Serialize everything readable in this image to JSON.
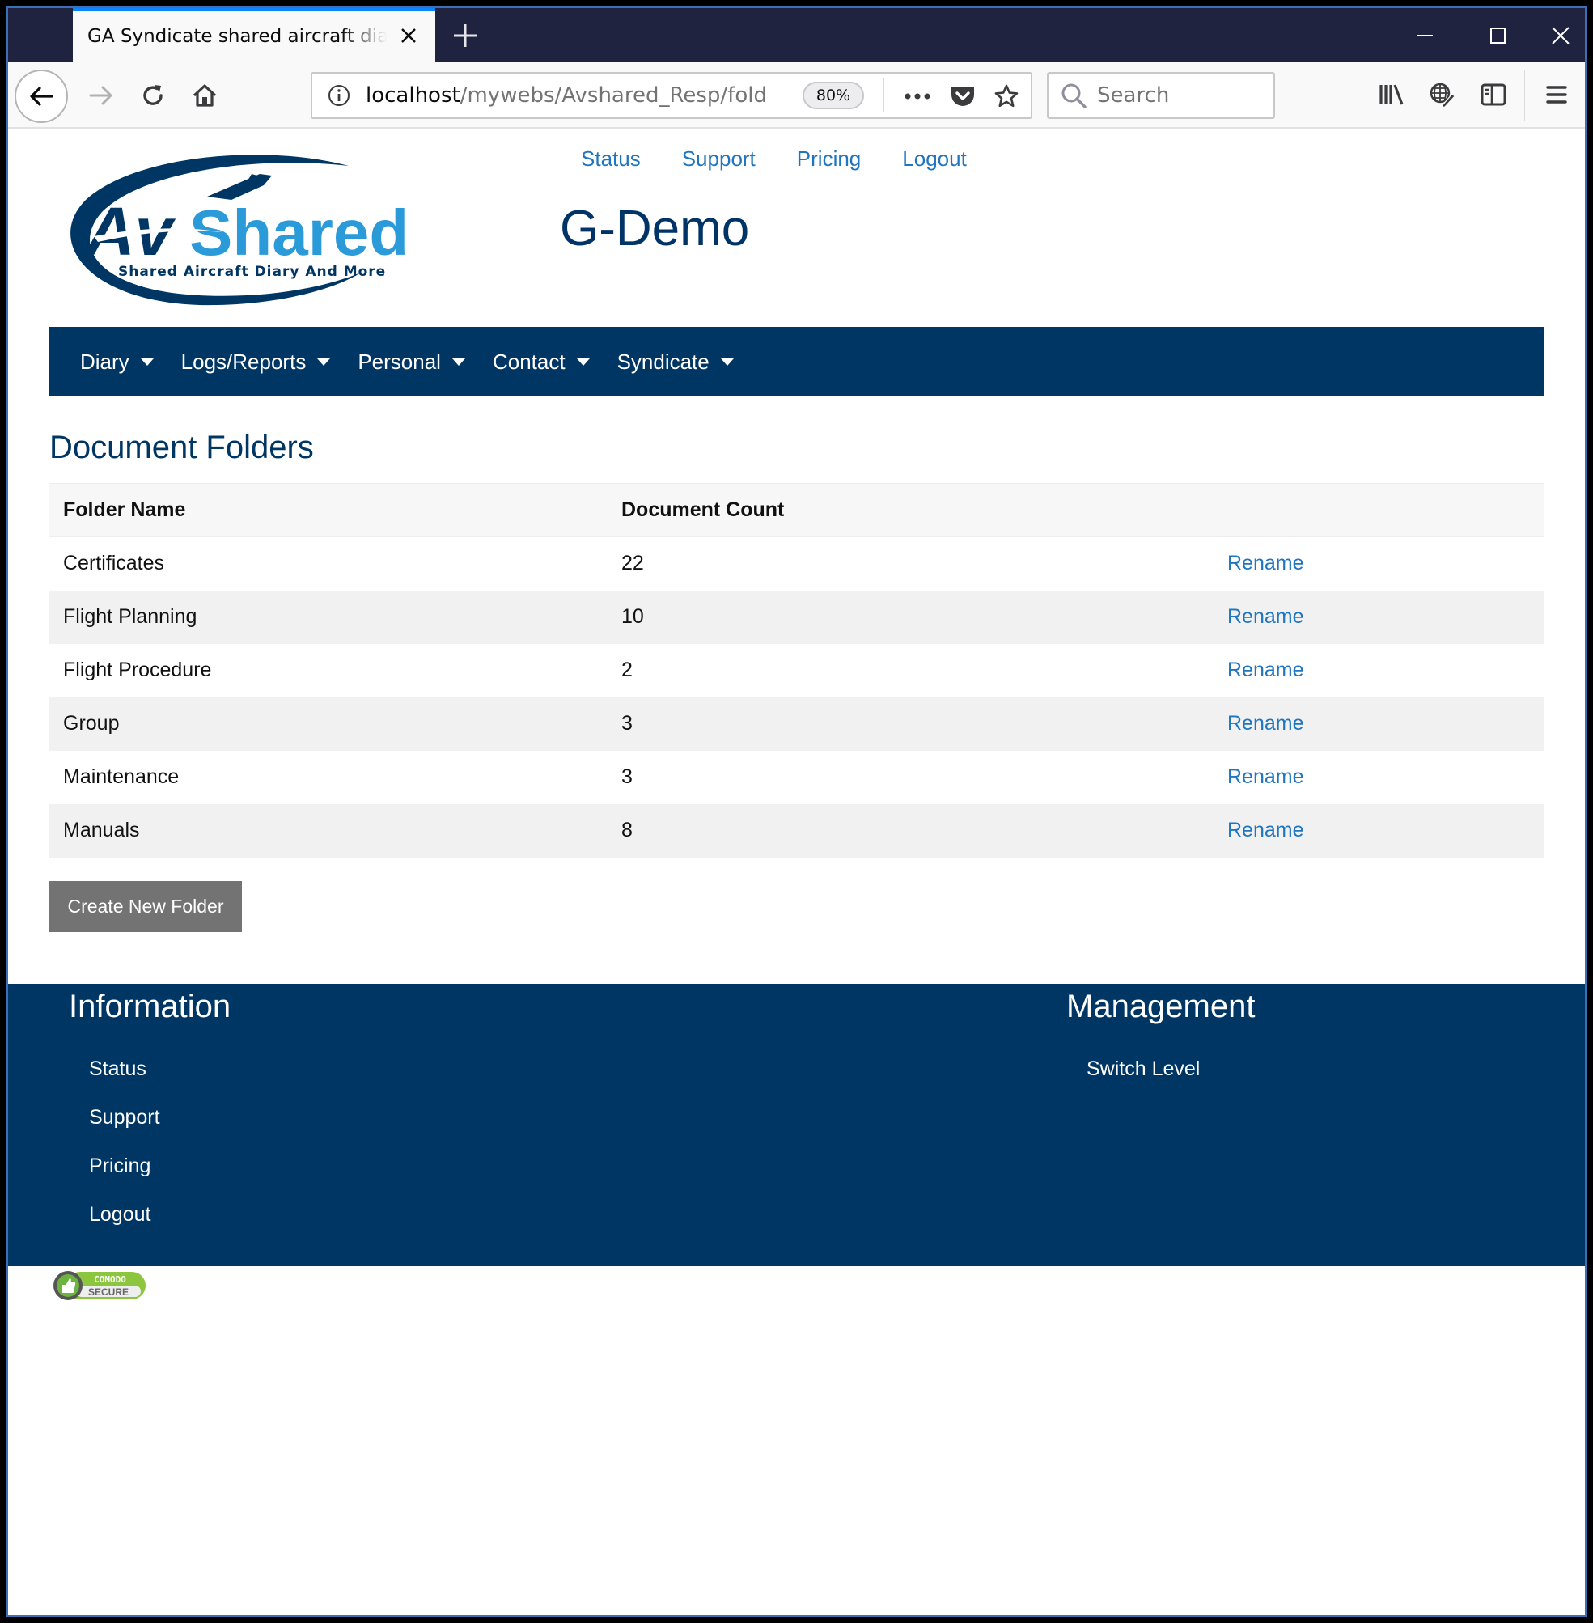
{
  "browser": {
    "tab_title": "GA Syndicate shared aircraft diary b",
    "url_host": "localhost",
    "url_path": "/mywebs/Avshared_Resp/fold",
    "zoom_level": "80%",
    "search_placeholder": "Search",
    "icons": {
      "tab_close": "close-icon",
      "new_tab": "plus-icon",
      "minimize": "minimize-icon",
      "maximize": "maximize-icon",
      "close_window": "close-icon",
      "back": "arrow-left-icon",
      "forward": "arrow-right-icon",
      "reload": "reload-icon",
      "home": "home-icon",
      "site_info": "info-icon",
      "page_actions": "more-horizontal-icon",
      "pocket": "pocket-icon",
      "bookmark": "star-icon",
      "search": "search-icon",
      "library": "library-icon",
      "translate": "globe-pencil-icon",
      "sidebar": "sidebar-icon",
      "menu": "hamburger-menu-icon"
    }
  },
  "site": {
    "logo": {
      "brand_part1": "Av",
      "brand_part2": "Shared",
      "tagline": "Shared Aircraft Diary And More"
    },
    "top_links": [
      "Status",
      "Support",
      "Pricing",
      "Logout"
    ],
    "title": "G-Demo",
    "colors": {
      "primary": "#003663",
      "link": "#1f75be",
      "logo_light": "#2a9ad8",
      "button_gray": "#737373"
    }
  },
  "main_nav": [
    {
      "label": "Diary"
    },
    {
      "label": "Logs/Reports"
    },
    {
      "label": "Personal"
    },
    {
      "label": "Contact"
    },
    {
      "label": "Syndicate"
    }
  ],
  "main": {
    "section_title": "Document Folders",
    "table": {
      "columns": [
        "Folder Name",
        "Document Count",
        ""
      ],
      "rows": [
        {
          "name": "Certificates",
          "count": "22",
          "action": "Rename"
        },
        {
          "name": "Flight Planning",
          "count": "10",
          "action": "Rename"
        },
        {
          "name": "Flight Procedure",
          "count": "2",
          "action": "Rename"
        },
        {
          "name": "Group",
          "count": "3",
          "action": "Rename"
        },
        {
          "name": "Maintenance",
          "count": "3",
          "action": "Rename"
        },
        {
          "name": "Manuals",
          "count": "8",
          "action": "Rename"
        }
      ]
    },
    "create_button": "Create New Folder"
  },
  "footer": {
    "information": {
      "heading": "Information",
      "links": [
        "Status",
        "Support",
        "Pricing",
        "Logout"
      ]
    },
    "management": {
      "heading": "Management",
      "links": [
        "Switch Level"
      ]
    },
    "badge": {
      "line1": "COMODO",
      "line2": "SECURE"
    }
  }
}
